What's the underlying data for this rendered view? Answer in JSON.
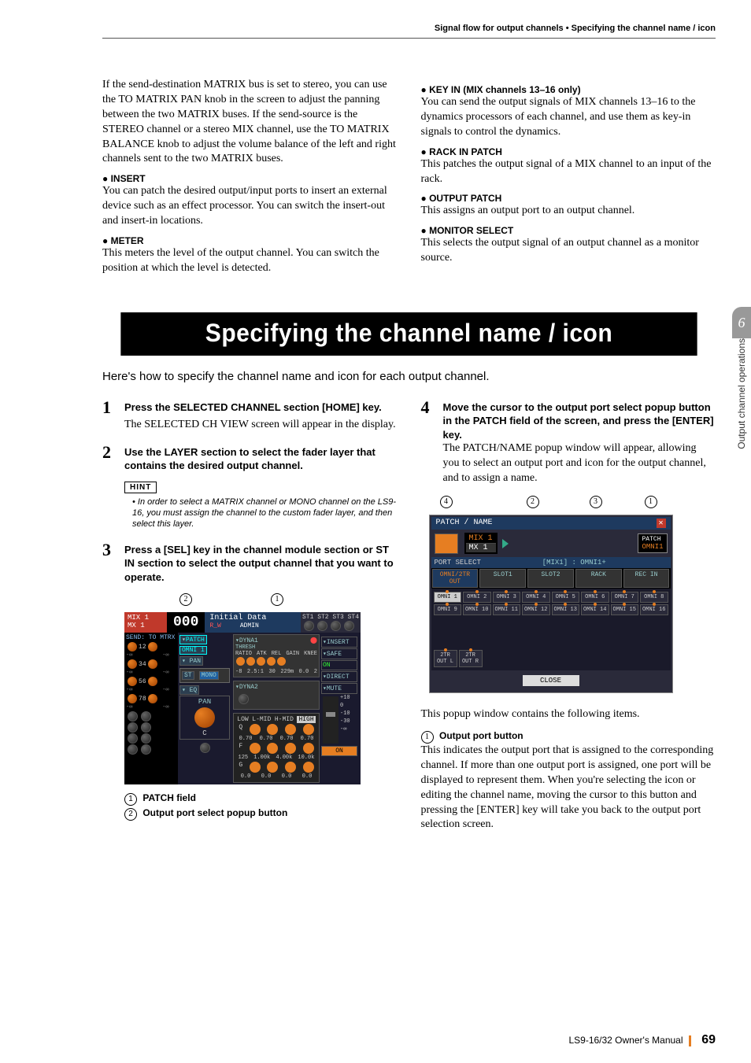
{
  "running_head": "Signal flow for output channels • Specifying the channel name / icon",
  "upper_left": {
    "intro": "If the send-destination MATRIX bus is set to stereo, you can use the TO MATRIX PAN knob in the screen to adjust the panning between the two MATRIX buses. If the send-source is the STEREO channel or a stereo MIX channel, use the TO MATRIX BALANCE knob to adjust the volume balance of the left and right channels sent to the two MATRIX buses.",
    "insert_head": "INSERT",
    "insert_body": "You can patch the desired output/input ports to insert an external device such as an effect processor. You can switch the insert-out and insert-in locations.",
    "meter_head": "METER",
    "meter_body": "This meters the level of the output channel. You can switch the position at which the level is detected."
  },
  "upper_right": {
    "keyin_head": "KEY IN (MIX channels 13–16 only)",
    "keyin_body": "You can send the output signals of MIX channels 13–16 to the dynamics processors of each channel, and use them as key-in signals to control the dynamics.",
    "rackin_head": "RACK IN PATCH",
    "rackin_body": "This patches the output signal of a MIX channel to an input of the rack.",
    "outpatch_head": "OUTPUT PATCH",
    "outpatch_body": "This assigns an output port to an output channel.",
    "monsel_head": "MONITOR SELECT",
    "monsel_body": "This selects the output signal of an output channel as a monitor source."
  },
  "section_banner": "Specifying the channel name / icon",
  "intro_line": "Here's how to specify the channel name and icon for each output channel.",
  "step1_title": "Press the SELECTED CHANNEL section [HOME] key.",
  "step1_body": "The SELECTED CH VIEW screen will appear in the display.",
  "step2_title": "Use the LAYER section to select the fader layer that contains the desired output channel.",
  "hint_label": "HINT",
  "hint_text": "• In order to select a MATRIX channel or MONO channel on the LS9-16, you must assign the channel to the custom fader layer, and then select this layer.",
  "step3_title": "Press a [SEL] key in the channel module section or ST IN section to select the output channel that you want to operate.",
  "callout_patch_field": "PATCH field",
  "callout_oport_popup": "Output port select popup button",
  "step4_title": "Move the cursor to the output port select popup button in the PATCH field of the screen, and press the [ENTER] key.",
  "step4_body": "The PATCH/NAME popup window will appear, allowing you to select an output port and icon for the output channel, and to assign a name.",
  "popup_desc": "This popup window contains the following items.",
  "item1_head": "Output port button",
  "item1_body": "This indicates the output port that is assigned to the corresponding channel. If more than one output port is assigned, one port will be displayed to represent them. When you're selecting the icon or editing the channel name, moving the cursor to this button and pressing the [ENTER] key will take you back to the output port selection screen.",
  "shot1": {
    "mix_top": "MIX 1",
    "mix_bottom": "MX 1",
    "counter": "000",
    "initial_data": "Initial Data",
    "rw": "R_W",
    "admin": "ADMIN",
    "send_to": "SEND: TO MTRX",
    "patch_label": "PATCH",
    "omni1": "OMNI 1",
    "pan_label": "PAN",
    "st": "ST",
    "mono": "MONO",
    "eq_label": "EQ",
    "c": "C",
    "pan2": "PAN",
    "dyna1": "DYNA1",
    "thresh": "THRESH",
    "ratio": "RATIO",
    "atk": "ATK",
    "rel": "REL",
    "gain": "GAIN",
    "knee": "KNEE",
    "dyna2": "DYNA2",
    "dyna_vals": [
      "-8",
      "2.5:1",
      "30",
      "229m",
      "0.0",
      "2"
    ],
    "eq_bands": [
      "LOW",
      "L-MID",
      "H-MID",
      "HIGH"
    ],
    "eq_rows": {
      "Q": [
        "0.70",
        "0.70",
        "0.70",
        "0.70"
      ],
      "F": [
        "125",
        "1.00k",
        "4.00k",
        "10.0k"
      ],
      "G": [
        "0.0",
        "0.0",
        "0.0",
        "0.0"
      ]
    },
    "safe_insert": "INSERT",
    "safe": "SAFE",
    "on": "ON",
    "direct": "DIRECT",
    "mute": "MUTE",
    "levels": [
      "+10",
      "0",
      "-10",
      "-30",
      "-∞"
    ]
  },
  "shot2": {
    "title": "PATCH / NAME",
    "mix1": "MIX 1",
    "mx1": "MX 1",
    "patch": "PATCH",
    "omni1": "OMNI1",
    "port_select": "PORT SELECT",
    "hint": "[MIX1] : OMNI1+",
    "tabs": [
      "OMNI/2TR OUT",
      "SLOT1",
      "SLOT2",
      "RACK",
      "REC IN"
    ],
    "omni_row1": [
      "OMNI 1",
      "OMNI 2",
      "OMNI 3",
      "OMNI 4",
      "OMNI 5",
      "OMNI 6",
      "OMNI 7",
      "OMNI 8"
    ],
    "omni_row2": [
      "OMNI 9",
      "OMNI 10",
      "OMNI 11",
      "OMNI 12",
      "OMNI 13",
      "OMNI 14",
      "OMNI 15",
      "OMNI 16"
    ],
    "bottom": [
      "2TR OUT L",
      "2TR OUT R"
    ],
    "close": "CLOSE"
  },
  "side_chapter": "6",
  "side_label": "Output channel operations",
  "footer_manual": "LS9-16/32  Owner's Manual",
  "footer_page": "69"
}
